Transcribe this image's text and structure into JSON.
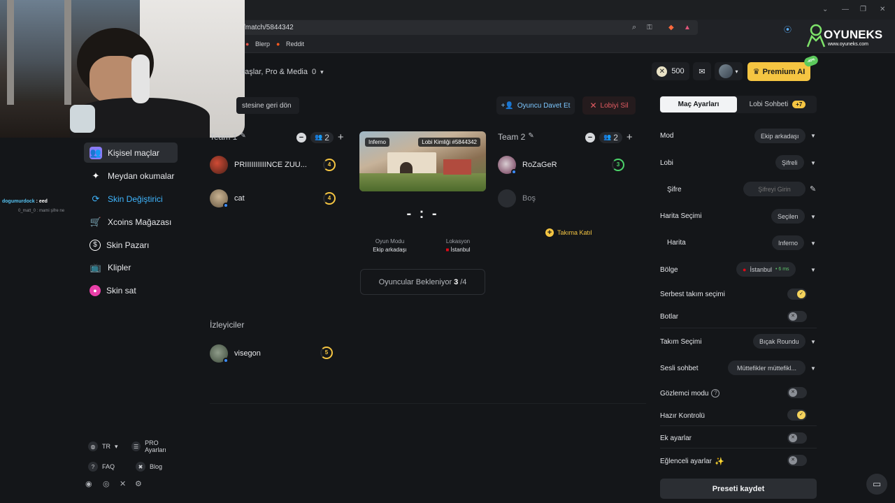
{
  "browser": {
    "url": "/match/5844342",
    "bookmarks": [
      "Blerp",
      "Reddit"
    ]
  },
  "logo": {
    "name": "OYUNEKS",
    "domain": "www.oyuneks.com"
  },
  "sidebar": {
    "items": [
      {
        "label": "Kişisel maçlar",
        "icon": "users-icon",
        "color": "#8b7cf6"
      },
      {
        "label": "Meydan okumalar",
        "icon": "puzzle-icon",
        "color": "#ffffff"
      },
      {
        "label": "Skin Değiştirici",
        "icon": "swap-icon",
        "color": "#3fb6ff"
      },
      {
        "label": "Xcoins Mağazası",
        "icon": "cart-icon",
        "color": "#ffffff"
      },
      {
        "label": "Skin Pazarı",
        "icon": "dollar-icon",
        "color": "#ffffff"
      },
      {
        "label": "Klipler",
        "icon": "tv-icon",
        "color": "#ffffff"
      },
      {
        "label": "Skin sat",
        "icon": "sell-icon",
        "color": "#e83fa8"
      }
    ],
    "footer": {
      "lang": "TR",
      "pro": "PRO Ayarları",
      "faq": "FAQ",
      "blog": "Blog"
    }
  },
  "chat": {
    "line1_user": "dogumurdock",
    "line1_text": ": eed",
    "line2": "0_matt_0 : mami şifre ne"
  },
  "topbar": {
    "filter_label": "daşlar, Pro & Media",
    "filter_count": "0",
    "coins": "500",
    "premium": "Premium AI",
    "premium_badge": "-40%"
  },
  "actions": {
    "back": "stesine geri dön",
    "invite": "Oyuncu Davet Et",
    "delete": "Lobiyi Sil"
  },
  "team1": {
    "title": "Team 1",
    "count": "2",
    "players": [
      {
        "name": "PRIIIIIIIIIINCE ZUU...",
        "level": "4"
      },
      {
        "name": "cat",
        "level": "4"
      }
    ]
  },
  "team2": {
    "title": "Team 2",
    "count": "2",
    "players": [
      {
        "name": "RoZaGeR",
        "level": "3"
      },
      {
        "name": "Boş"
      }
    ],
    "join": "Takıma Katıl"
  },
  "match": {
    "map": "Inferno",
    "lobby_id": "Lobi Kimliği #5844342",
    "score": "- : -",
    "mode_label": "Oyun Modu",
    "mode_value": "Ekip arkadaşı",
    "loc_label": "Lokasyon",
    "loc_value": "İstanbul",
    "waiting_text": "Oyuncular Bekleniyor",
    "waiting_count": "3",
    "waiting_total": "/4"
  },
  "spectators": {
    "title": "İzleyiciler",
    "players": [
      {
        "name": "visegon",
        "level": "5"
      }
    ]
  },
  "settings": {
    "tab_match": "Maç Ayarları",
    "tab_chat": "Lobi Sohbeti",
    "chat_badge": "+7",
    "rows": [
      {
        "label": "Mod",
        "value": "Ekip arkadaşı"
      },
      {
        "label": "Lobi",
        "value": "Şifreli"
      },
      {
        "label": "Şifre",
        "placeholder": "Şifreyi Girin"
      },
      {
        "label": "Harita Seçimi",
        "value": "Seçilen"
      },
      {
        "label": "Harita",
        "value": "Inferno"
      },
      {
        "label": "Bölge",
        "value": "İstanbul",
        "ping": "• 6 ms"
      },
      {
        "label": "Serbest takım seçimi",
        "toggle": true
      },
      {
        "label": "Botlar",
        "toggle": false
      },
      {
        "label": "Takım Seçimi",
        "value": "Bıçak Roundu"
      },
      {
        "label": "Sesli sohbet",
        "value": "Müttefikler müttefikl..."
      },
      {
        "label": "Gözlemci modu",
        "toggle": false
      },
      {
        "label": "Hazır Kontrolü",
        "toggle": true
      },
      {
        "label": "Ek ayarlar",
        "toggle": false
      },
      {
        "label": "Eğlenceli ayarlar",
        "toggle": false
      }
    ],
    "save": "Preseti kaydet"
  }
}
